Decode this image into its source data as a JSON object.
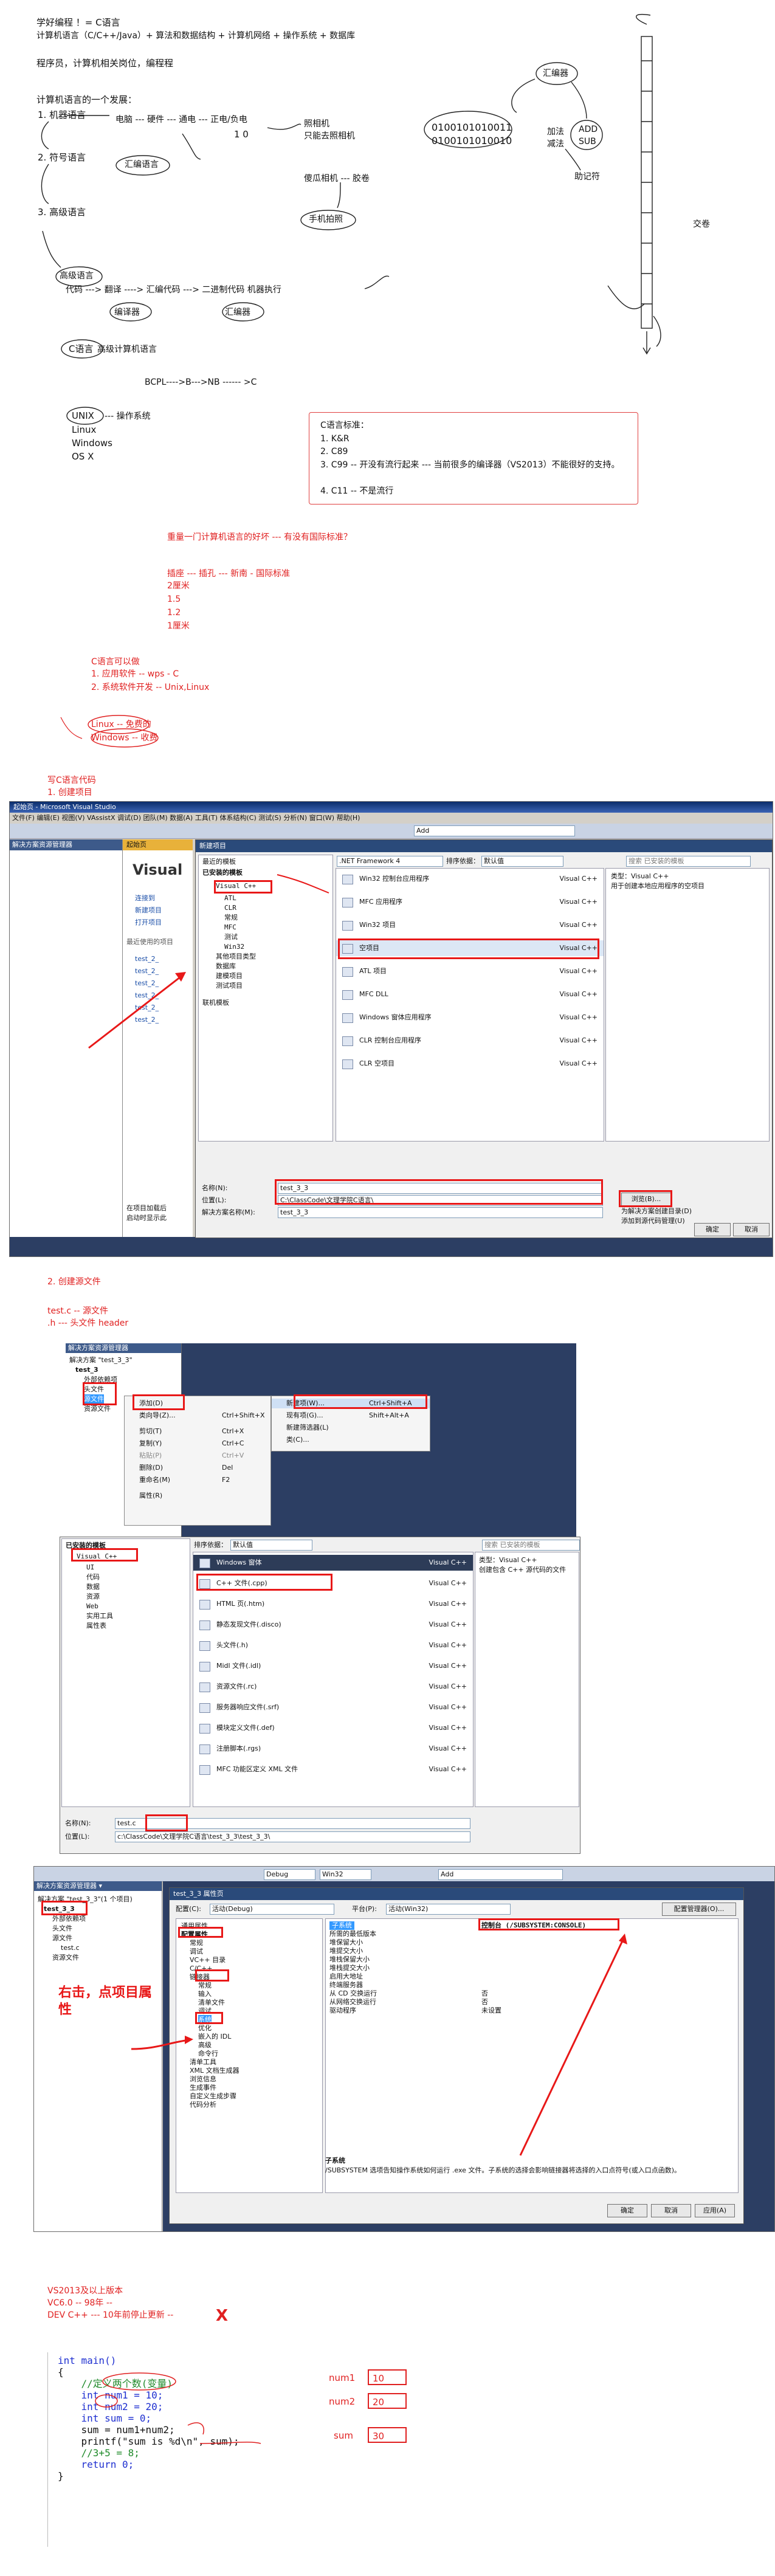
{
  "notes": {
    "line1": "学好编程 ！= C语言",
    "line2": "计算机语言（C/C++/Java）+ 算法和数据结构 + 计算机网络 + 操作系统 + 数据库",
    "line3": "程序员，计算机相关岗位，编程程",
    "history_title": "计算机语言的一个发展：",
    "h1": "1. 机器语言",
    "h1_chain": "电脑 --- 硬件 --- 通电 --- 正电/负电",
    "h1_bits": "1      0",
    "h1_note1": "照相机",
    "h1_note2": "只能去照相机",
    "binary1": "0100101010011",
    "binary2": "0100101010010",
    "mnemonic1": "ADD",
    "mnemonic2": "SUB",
    "op1": "加法",
    "op2": "减法",
    "assembler": "汇编器",
    "assembly_label": "助记符",
    "h2": "2. 符号语言",
    "h2_note": "汇编语言",
    "h2_cam": "傻瓜相机 ---  胶卷",
    "h3": "3. 高级语言",
    "h3_cam": "手机拍照",
    "film": "交卷",
    "high_level": "高级语言",
    "flow_line": "代码 ---> 翻译 ----> 汇编代码 ---> 二进制代码        机器执行",
    "compiler": "编译器",
    "assembler2": "汇编器",
    "c_lang": "C语言",
    "c_lang_note": "高级计算机语言",
    "bcpl": "BCPL---->B--->NB ------ >C",
    "unix": "UNIX",
    "unix_note": "--- 操作系统",
    "os_list": [
      "Linux",
      "Windows",
      "OS X"
    ],
    "std_title": "C语言标准：",
    "std_items": [
      "1. K&R",
      "2. C89",
      "3. C99 -- 开没有流行起来 --- 当前很多的编译器（VS2013）不能很好的支持。",
      "4. C11 -- 不是流行"
    ],
    "red_q": "重量一门计算机语言的好坏 --- 有没有国际标准？",
    "red_plug": "插座 --- 插孔 --- 新南 - 国际标准",
    "red_nums": [
      "2厘米",
      "1.5",
      "1.2",
      "1厘米"
    ],
    "red_c_title": "C语言可以做",
    "red_c1": "1. 应用软件 -- wps - C",
    "red_c2": "2. 系统软件开发 -- Unix,Linux",
    "red_linux": "Linux -- 免费的",
    "red_windows": "Windows -- 收费",
    "write_c": "写C语言代码",
    "create_proj": "1. 创建项目",
    "create_file": "2. 创建源文件",
    "testc": "test.c -- 源文件",
    "h_file": ".h ---    头文件 header",
    "annot_prop": "右击，点项目属性",
    "vs_versions": [
      "VS2013及以上版本",
      "VC6.0 -- 98年 --",
      "DEV C++ --- 10年前停止更新 --"
    ],
    "x_mark": "X"
  },
  "shot1": {
    "title": "起始页 - Microsoft Visual Studio",
    "menubar": "文件(F)  编辑(E)  视图(V)  VAssistX  调试(D)  团队(M)  数据(A)  工具(T)  体系结构(C)  测试(S)  分析(N)  窗口(W)  帮助(H)",
    "search": "Add",
    "left_panel_title": "解决方案资源管理器",
    "start_tab": "起始页",
    "start_logo": "Visual",
    "start_links": [
      "连接到",
      "新建项目",
      "打开项目"
    ],
    "recent_title": "最近使用的项目",
    "recent": [
      "test_2_",
      "test_2_",
      "test_2_",
      "test_2_",
      "test_2_",
      "test_2_"
    ],
    "checks": [
      "在项目加载后",
      "启动时显示此"
    ],
    "dialog_title": "新建项目",
    "recent_templates": "最近的模板",
    "installed_templates": "已安装的模板",
    "tree": [
      "Visual C++",
      "ATL",
      "CLR",
      "常规",
      "MFC",
      "测试",
      "Win32",
      "其他项目类型",
      "数据库",
      "建模项目",
      "测试项目"
    ],
    "online": "联机模板",
    "framework": ".NET Framework 4",
    "sort_label": "排序依据：",
    "sort_value": "默认值",
    "search_placeholder": "搜索 已安装的模板",
    "templates": [
      {
        "name": "Win32 控制台应用程序",
        "lang": "Visual C++"
      },
      {
        "name": "MFC 应用程序",
        "lang": "Visual C++"
      },
      {
        "name": "Win32 项目",
        "lang": "Visual C++"
      },
      {
        "name": "空项目",
        "lang": "Visual C++"
      },
      {
        "name": "ATL 项目",
        "lang": "Visual C++"
      },
      {
        "name": "MFC DLL",
        "lang": "Visual C++"
      },
      {
        "name": "Windows 窗体应用程序",
        "lang": "Visual C++"
      },
      {
        "name": "CLR 控制台应用程序",
        "lang": "Visual C++"
      },
      {
        "name": "CLR 空项目",
        "lang": "Visual C++"
      }
    ],
    "type_label": "类型：Visual C++",
    "type_desc": "用于创建本地应用程序的空项目",
    "name_label": "名称(N):",
    "name_value": "test_3_3",
    "loc_label": "位置(L):",
    "loc_value": "C:\\ClassCode\\文理学院C语言\\",
    "sol_label": "解决方案名称(M):",
    "sol_value": "test_3_3",
    "browse": "浏览(B)...",
    "cb1": "为解决方案创建目录(D)",
    "cb2": "添加到源代码管理(U)",
    "ok": "确定",
    "cancel": "取消"
  },
  "shot2": {
    "panel_title": "解决方案资源管理器",
    "solution": "解决方案 \"test_3_3\"",
    "project": "test_3",
    "nodes": [
      "外部依赖项",
      "头文件",
      "源文件",
      "资源文件"
    ],
    "ctx": [
      {
        "label": "添加(D)",
        "key": ""
      },
      {
        "label": "类向导(Z)...",
        "key": "Ctrl+Shift+X"
      },
      {
        "label": "剪切(T)",
        "key": "Ctrl+X"
      },
      {
        "label": "复制(Y)",
        "key": "Ctrl+C"
      },
      {
        "label": "粘贴(P)",
        "key": "Ctrl+V"
      },
      {
        "label": "删除(D)",
        "key": "Del"
      },
      {
        "label": "重命名(M)",
        "key": "F2"
      },
      {
        "label": "属性(R)",
        "key": ""
      }
    ],
    "sub": [
      {
        "label": "新建项(W)...",
        "key": "Ctrl+Shift+A"
      },
      {
        "label": "现有项(G)...",
        "key": "Shift+Alt+A"
      },
      {
        "label": "新建筛选器(L)",
        "key": ""
      },
      {
        "label": "类(C)...",
        "key": ""
      }
    ]
  },
  "shot3": {
    "installed": "已安装的模板",
    "tree": [
      "Visual C++",
      "UI",
      "代码",
      "数据",
      "资源",
      "Web",
      "实用工具",
      "属性表"
    ],
    "sort_label": "排序依据：",
    "sort_value": "默认值",
    "search": "搜索 已安装的模板",
    "items": [
      {
        "name": "Windows 窗体",
        "lang": "Visual C++"
      },
      {
        "name": "C++ 文件(.cpp)",
        "lang": "Visual C++"
      },
      {
        "name": "HTML 页(.htm)",
        "lang": "Visual C++"
      },
      {
        "name": "静态发现文件(.disco)",
        "lang": "Visual C++"
      },
      {
        "name": "头文件(.h)",
        "lang": "Visual C++"
      },
      {
        "name": "Midl 文件(.idl)",
        "lang": "Visual C++"
      },
      {
        "name": "资源文件(.rc)",
        "lang": "Visual C++"
      },
      {
        "name": "服务器响应文件(.srf)",
        "lang": "Visual C++"
      },
      {
        "name": "模块定义文件(.def)",
        "lang": "Visual C++"
      },
      {
        "name": "注册脚本(.rgs)",
        "lang": "Visual C++"
      },
      {
        "name": "MFC 功能区定义 XML 文件",
        "lang": "Visual C++"
      }
    ],
    "type_label": "类型：Visual C++",
    "type_desc": "创建包含 C++ 源代码的文件",
    "name_label": "名称(N):",
    "name_value": "test.c",
    "loc_label": "位置(L):",
    "loc_value": "c:\\ClassCode\\文理学院C语言\\test_3_3\\test_3_3\\"
  },
  "shot4": {
    "panel_title": "解决方案资源管理器 ▾",
    "solution": "解决方案 \"test_3_3\"(1 个项目)",
    "project": "test_3_3",
    "nodes": [
      "外部依赖项",
      "头文件",
      "源文件",
      "test.c",
      "资源文件"
    ],
    "toolbar_debug": "Debug",
    "toolbar_platform": "Win32",
    "toolbar_search": "Add",
    "dlg_title": "test_3_3 属性页",
    "config_label": "配置(C):",
    "config_value": "活动(Debug)",
    "platform_label": "平台(P):",
    "platform_value": "活动(Win32)",
    "cfg_mgr": "配置管理器(O)...",
    "tree": [
      "通用属性",
      "配置属性",
      "常规",
      "调试",
      "VC++ 目录",
      "C/C++",
      "链接器",
      "常规",
      "输入",
      "清单文件",
      "调试",
      "系统",
      "优化",
      "嵌入的 IDL",
      "高级",
      "命令行",
      "清单工具",
      "XML 文档生成器",
      "浏览信息",
      "生成事件",
      "自定义生成步骤",
      "代码分析"
    ],
    "props": [
      {
        "k": "子系统",
        "v": "控制台 (/SUBSYSTEM:CONSOLE)"
      },
      {
        "k": "所需的最低版本",
        "v": ""
      },
      {
        "k": "堆保留大小",
        "v": ""
      },
      {
        "k": "堆提交大小",
        "v": ""
      },
      {
        "k": "堆栈保留大小",
        "v": ""
      },
      {
        "k": "堆栈提交大小",
        "v": ""
      },
      {
        "k": "启用大地址",
        "v": ""
      },
      {
        "k": "终端服务器",
        "v": ""
      },
      {
        "k": "从 CD 交换运行",
        "v": "否"
      },
      {
        "k": "从网络交换运行",
        "v": "否"
      },
      {
        "k": "驱动程序",
        "v": "未设置"
      }
    ],
    "desc_title": "子系统",
    "desc": "/SUBSYSTEM 选项告知操作系统如何运行 .exe 文件。子系统的选择会影响链接器将选择的入口点符号(或入口点函数)。",
    "ok": "确定",
    "cancel": "取消",
    "apply": "应用(A)"
  },
  "code": {
    "lines": [
      {
        "t": "int main()",
        "c": "kw"
      },
      {
        "t": "{",
        "c": ""
      },
      {
        "t": "    //定义两个数(变量)",
        "c": "cm"
      },
      {
        "t": "    int num1 = 10;",
        "c": ""
      },
      {
        "t": "    int num2 = 20;",
        "c": ""
      },
      {
        "t": "    int sum = 0;",
        "c": ""
      },
      {
        "t": "    sum = num1+num2;",
        "c": ""
      },
      {
        "t": "    printf(\"sum is %d\\n\", sum);",
        "c": ""
      },
      {
        "t": "    //3+5 = 8;",
        "c": "cm"
      },
      {
        "t": "    return 0;",
        "c": ""
      },
      {
        "t": "}",
        "c": ""
      }
    ],
    "vars": [
      {
        "name": "num1",
        "value": "10"
      },
      {
        "name": "num2",
        "value": "20"
      },
      {
        "name": "sum",
        "value": "30"
      }
    ]
  }
}
